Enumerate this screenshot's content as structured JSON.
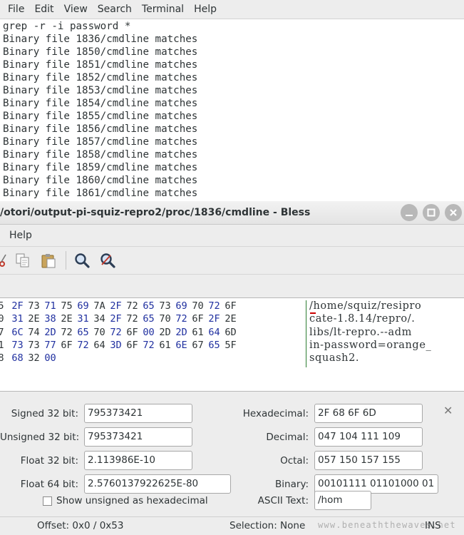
{
  "terminal": {
    "menus": [
      "File",
      "Edit",
      "View",
      "Search",
      "Terminal",
      "Help"
    ],
    "command": "grep -r -i password *",
    "output": [
      "Binary file 1836/cmdline matches",
      "Binary file 1850/cmdline matches",
      "Binary file 1851/cmdline matches",
      "Binary file 1852/cmdline matches",
      "Binary file 1853/cmdline matches",
      "Binary file 1854/cmdline matches",
      "Binary file 1855/cmdline matches",
      "Binary file 1856/cmdline matches",
      "Binary file 1857/cmdline matches",
      "Binary file 1858/cmdline matches",
      "Binary file 1859/cmdline matches",
      "Binary file 1860/cmdline matches",
      "Binary file 1861/cmdline matches"
    ]
  },
  "bless": {
    "title": "/otori/output-pi-squiz-repro2/proc/1836/cmdline - Bless",
    "menu": {
      "help": "Help"
    },
    "hex_rows": [
      [
        "5",
        "2F",
        "73",
        "71",
        "75",
        "69",
        "7A",
        "2F",
        "72",
        "65",
        "73",
        "69",
        "70",
        "72",
        "6F"
      ],
      [
        "0",
        "31",
        "2E",
        "38",
        "2E",
        "31",
        "34",
        "2F",
        "72",
        "65",
        "70",
        "72",
        "6F",
        "2F",
        "2E"
      ],
      [
        "7",
        "6C",
        "74",
        "2D",
        "72",
        "65",
        "70",
        "72",
        "6F",
        "00",
        "2D",
        "2D",
        "61",
        "64",
        "6D"
      ],
      [
        "1",
        "73",
        "73",
        "77",
        "6F",
        "72",
        "64",
        "3D",
        "6F",
        "72",
        "61",
        "6E",
        "67",
        "65",
        "5F"
      ],
      [
        "8",
        "68",
        "32",
        "00"
      ]
    ],
    "ascii_rows": [
      "/home/squiz/resipro",
      "cate-1.8.14/repro/.",
      "libs/lt-repro.--adm",
      "in-password=orange_",
      "squash2."
    ],
    "conversion": {
      "signed32_label": "Signed 32 bit:",
      "signed32": "795373421",
      "unsigned32_label": "Unsigned 32 bit:",
      "unsigned32": "795373421",
      "float32_label": "Float 32 bit:",
      "float32": "2.113986E-10",
      "float64_label": "Float 64 bit:",
      "float64": "2.5760137922625E-80",
      "show_unsigned_hex_label": "Show unsigned as hexadecimal",
      "hex_label": "Hexadecimal:",
      "hex": "2F 68 6F 6D",
      "decimal_label": "Decimal:",
      "decimal": "047 104 111 109",
      "octal_label": "Octal:",
      "octal": "057 150 157 155",
      "binary_label": "Binary:",
      "binary": "00101111 01101000 01",
      "ascii_label": "ASCII Text:",
      "ascii": "/hom"
    },
    "status": {
      "offset": "Offset: 0x0 / 0x53",
      "selection": "Selection: None",
      "mode": "INS"
    },
    "watermark": "www.beneaththewaves.net"
  }
}
